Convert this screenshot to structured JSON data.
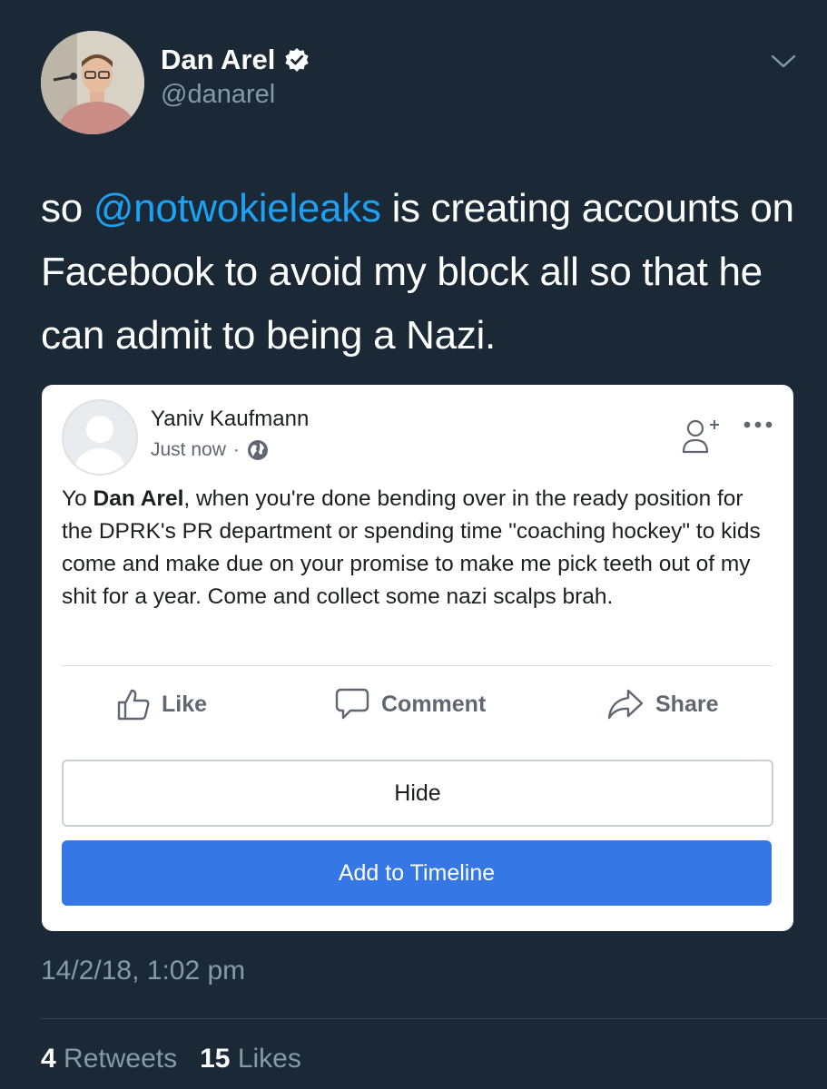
{
  "tweet": {
    "author_name": "Dan Arel",
    "handle": "@danarel",
    "text_prefix": "so ",
    "mention": "@notwokieleaks",
    "text_suffix": " is creating accounts on Facebook to avoid my block all so that he can admit to being a Nazi.",
    "timestamp": "14/2/18, 1:02 pm",
    "retweets_count": "4",
    "retweets_label": "Retweets",
    "likes_count": "15",
    "likes_label": "Likes"
  },
  "fb_post": {
    "author_name": "Yaniv Kaufmann",
    "time": "Just now",
    "separator": "·",
    "text_prefix": "Yo ",
    "text_bold": "Dan Arel",
    "text_suffix": ", when you're done bending over in the ready position for the DPRK's PR department or spending time \"coaching hockey\" to kids come and make due on your promise to make me pick teeth out of my shit for a year. Come and collect some nazi scalps brah.",
    "actions": {
      "like": "Like",
      "comment": "Comment",
      "share": "Share"
    },
    "hide_label": "Hide",
    "add_to_timeline_label": "Add to Timeline"
  },
  "icons": {
    "verified": "verified-badge-icon",
    "chevron": "chevron-down-icon",
    "globe": "globe-icon",
    "add_friend": "add-friend-icon",
    "more": "more-dots-icon",
    "like": "thumbs-up-icon",
    "comment": "speech-bubble-icon",
    "share": "share-arrow-icon"
  },
  "colors": {
    "background": "#1b2836",
    "link": "#1da1f2",
    "secondary_text": "#8899a6",
    "fb_blue": "#3578e5"
  }
}
